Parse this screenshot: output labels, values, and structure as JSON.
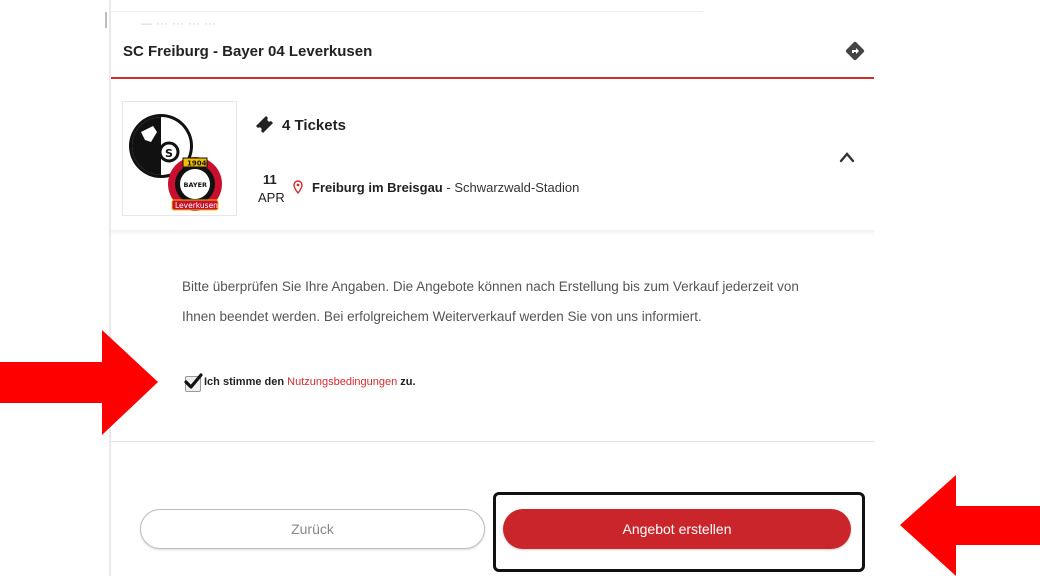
{
  "header": {
    "ghost_text": "— ··· ··· ··· ···",
    "event_title": "SC Freiburg - Bayer 04 Leverkusen"
  },
  "icons": {
    "directions": "directions-icon",
    "ticket": "ticket-icon",
    "pin": "map-pin-icon",
    "chevron": "chevron-up-icon",
    "check": "check-icon"
  },
  "listing": {
    "ticket_count": "4 Tickets",
    "date_day": "11",
    "date_month": "APR",
    "city": "Freiburg im Breisgau",
    "venue_separator": " - ",
    "stadium": "Schwarzwald-Stadion",
    "logo_badge_year": "1904",
    "logo_badge_name": "BAYER",
    "logo_ribbon": "Leverkusen"
  },
  "notice": {
    "text": "Bitte überprüfen Sie Ihre Angaben. Die Angebote können nach Erstellung bis zum Verkauf jederzeit von Ihnen beendet werden. Bei erfolgreichem Weiterverkauf werden Sie von uns informiert."
  },
  "terms": {
    "prefix": "Ich stimme den ",
    "link": "Nutzungsbedingungen",
    "suffix": " zu.",
    "checked": true
  },
  "actions": {
    "back_label": "Zurück",
    "create_label": "Angebot erstellen"
  },
  "colors": {
    "accent_red": "#c9252b",
    "rule_red": "#d42b2b",
    "annotation_arrow": "#ff0000"
  }
}
